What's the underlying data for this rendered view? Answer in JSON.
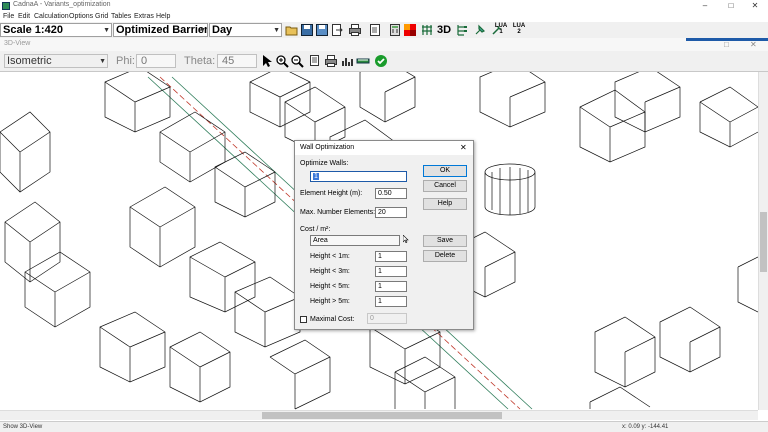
{
  "window": {
    "title": "CadnaA - Variants_optimization",
    "minimize": "–",
    "maximize": "□",
    "close": "✕"
  },
  "menu": [
    "File",
    "Edit",
    "Calculation",
    "Options",
    "Grid",
    "Tables",
    "Extras",
    "Help"
  ],
  "toolbar": {
    "scale": "Scale 1:420",
    "variant": "Optimized Barrier",
    "period": "Day",
    "label_3d": "3D",
    "lua1": "LUA",
    "lua1_num": "1",
    "lua2": "LUA",
    "lua2_num": "2"
  },
  "view": {
    "title": "3D-View",
    "projection": "Isometric",
    "phi_label": "Phi:",
    "phi_value": "0",
    "theta_label": "Theta:",
    "theta_value": "45",
    "maximize": "□",
    "close": "✕"
  },
  "colors": {
    "accent_blue": "#1e5aa8",
    "ok_green": "#1a9c2c",
    "road_red": "#c0392b"
  },
  "dialog": {
    "title": "Wall Optimization",
    "close": "✕",
    "optimize_walls_label": "Optimize Walls:",
    "optimize_walls_value": "1",
    "element_height_label": "Element Height (m):",
    "element_height_value": "0.50",
    "max_elements_label": "Max. Number Elements:",
    "max_elements_value": "20",
    "cost_label": "Cost / m²:",
    "cost_mode": "Area",
    "heights": [
      {
        "label": "Height < 1m:",
        "value": "1"
      },
      {
        "label": "Height < 3m:",
        "value": "1"
      },
      {
        "label": "Height < 5m:",
        "value": "1"
      },
      {
        "label": "Height > 5m:",
        "value": "1"
      }
    ],
    "maximal_cost_label": "Maximal Cost:",
    "maximal_cost_value": "0",
    "ok": "OK",
    "cancel": "Cancel",
    "help": "Help",
    "save": "Save",
    "delete": "Delete"
  },
  "status": {
    "left": "Show 3D-View",
    "coords": "x: 0.09  y: -144.41"
  }
}
